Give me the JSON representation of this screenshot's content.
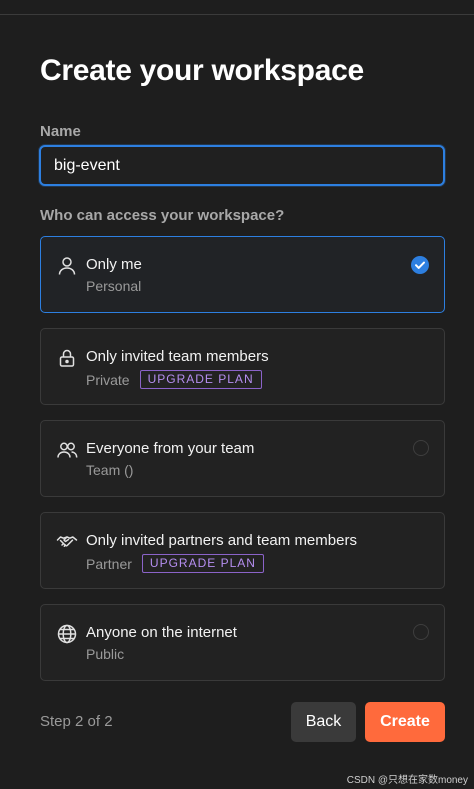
{
  "title": "Create your workspace",
  "name_field": {
    "label": "Name",
    "value": "big-event"
  },
  "access": {
    "label": "Who can access your workspace?",
    "options": [
      {
        "title": "Only me",
        "subtitle": "Personal",
        "badge": "",
        "icon": "person-icon",
        "selected": true
      },
      {
        "title": "Only invited team members",
        "subtitle": "Private",
        "badge": "UPGRADE PLAN",
        "icon": "lock-icon",
        "selected": false
      },
      {
        "title": "Everyone from your team",
        "subtitle": "Team ()",
        "badge": "",
        "icon": "team-icon",
        "selected": false
      },
      {
        "title": "Only invited partners and team members",
        "subtitle": "Partner",
        "badge": "UPGRADE PLAN",
        "icon": "handshake-icon",
        "selected": false
      },
      {
        "title": "Anyone on the internet",
        "subtitle": "Public",
        "badge": "",
        "icon": "globe-icon",
        "selected": false
      }
    ]
  },
  "footer": {
    "step": "Step 2 of 2",
    "back_label": "Back",
    "create_label": "Create"
  },
  "watermark": "CSDN @只想在家数money",
  "colors": {
    "background": "#1e1e1e",
    "accent_blue": "#2d7fe0",
    "create_orange": "#ff6a3c",
    "badge_purple": "#8b63c9"
  }
}
